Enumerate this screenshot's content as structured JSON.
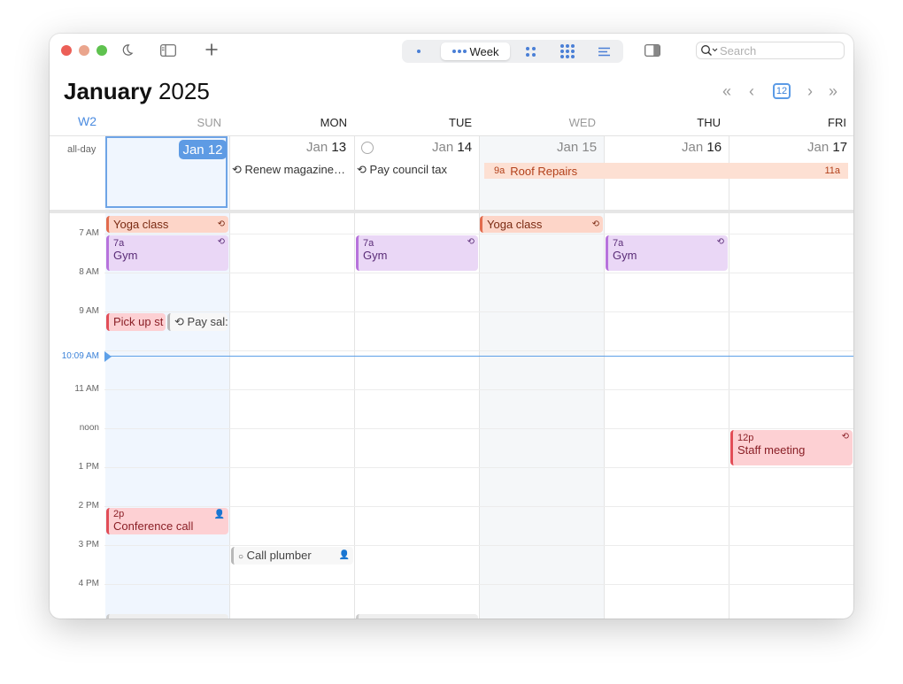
{
  "toolbar": {
    "view_label": "Week",
    "search_placeholder": "Search",
    "today_day": "12"
  },
  "header": {
    "month": "January",
    "year": "2025",
    "week_number": "W2"
  },
  "days": [
    {
      "name": "SUN",
      "month": "Jan",
      "day": "12"
    },
    {
      "name": "MON",
      "month": "Jan",
      "day": "13"
    },
    {
      "name": "TUE",
      "month": "Jan",
      "day": "14"
    },
    {
      "name": "WED",
      "month": "Jan",
      "day": "15"
    },
    {
      "name": "THU",
      "month": "Jan",
      "day": "16"
    },
    {
      "name": "FRI",
      "month": "Jan",
      "day": "17"
    }
  ],
  "today_label": "Jan 12",
  "allday": {
    "label": "all-day",
    "mon_task": "Renew magazine…",
    "tue_task": "Pay council tax",
    "banner": {
      "start": "9a",
      "title": "Roof Repairs",
      "end": "11a"
    }
  },
  "time_labels": [
    "7 AM",
    "8 AM",
    "9 AM",
    "10:09 AM",
    "11 AM",
    "noon",
    "1 PM",
    "2 PM",
    "3 PM",
    "4 PM"
  ],
  "events": {
    "yoga_sun": "Yoga class",
    "yoga_wed": "Yoga class",
    "gym_time": "7a",
    "gym_title": "Gym",
    "pickup": "Pick up st",
    "paysal": "Pay sal:",
    "staff_time": "12p",
    "staff_title": "Staff meeting",
    "conf_time": "2p",
    "conf_title": "Conference call",
    "plumber": "Call plumber"
  },
  "colors": {
    "accent": "#5e9be4",
    "salmon": "#fdd5c8",
    "purple": "#ead7f6",
    "red": "#fdd0d3"
  }
}
